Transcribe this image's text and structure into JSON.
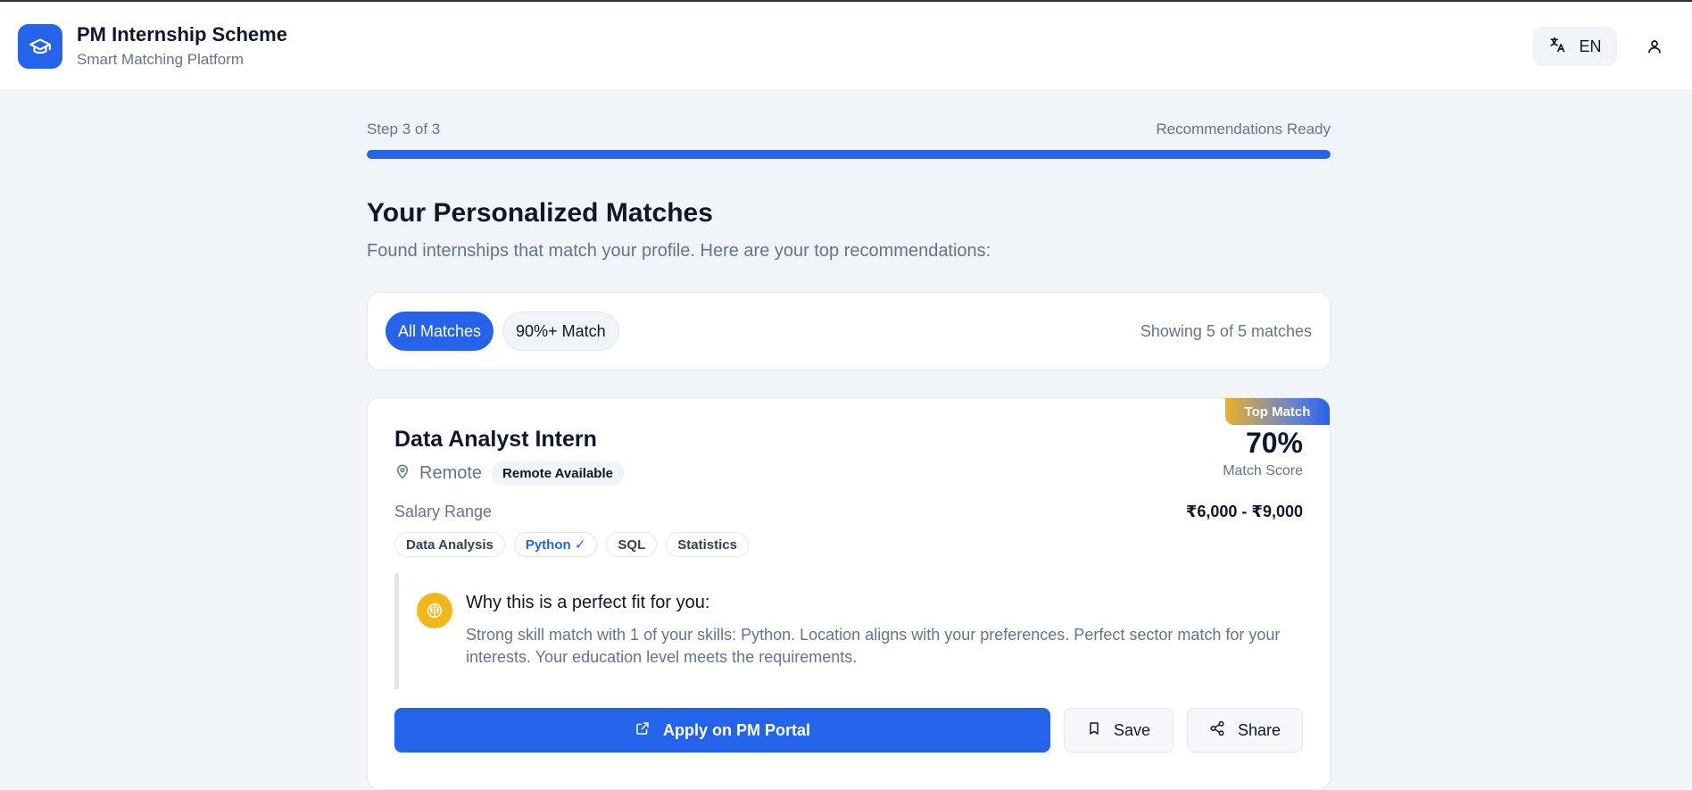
{
  "header": {
    "title": "PM Internship Scheme",
    "subtitle": "Smart Matching Platform",
    "language": "EN"
  },
  "progress": {
    "step_label": "Step 3 of 3",
    "status_label": "Recommendations Ready",
    "percent": 100
  },
  "main": {
    "title": "Your Personalized Matches",
    "subtitle": "Found internships that match your profile. Here are your top recommendations:"
  },
  "filters": {
    "items": [
      "All Matches",
      "90%+ Match"
    ],
    "active": "All Matches",
    "showing": "Showing 5 of 5 matches"
  },
  "card": {
    "badge": "Top Match",
    "title": "Data Analyst Intern",
    "location": "Remote",
    "remote_badge": "Remote Available",
    "score": "70%",
    "score_label": "Match Score",
    "salary_label": "Salary Range",
    "salary": "₹6,000 - ₹9,000",
    "skills": [
      {
        "label": "Data Analysis",
        "matched": false
      },
      {
        "label": "Python ✓",
        "matched": true
      },
      {
        "label": "SQL",
        "matched": false
      },
      {
        "label": "Statistics",
        "matched": false
      }
    ],
    "why_title": "Why this is a perfect fit for you:",
    "why_text": "Strong skill match with 1 of your skills: Python. Location aligns with your preferences. Perfect sector match for your interests. Your education level meets the requirements.",
    "apply_label": "Apply on PM Portal",
    "save_label": "Save",
    "share_label": "Share"
  },
  "colors": {
    "accent": "#2563eb",
    "badge_gold": "#e9b12c",
    "brain_bg": "#f4b719"
  }
}
